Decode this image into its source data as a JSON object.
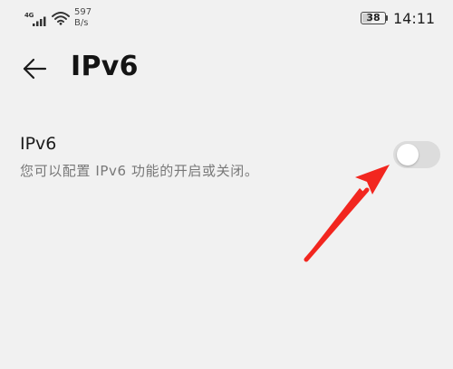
{
  "status_bar": {
    "network_type": "4G",
    "net_speed_value": "597",
    "net_speed_unit": "B/s",
    "battery_level": "38",
    "battery_fraction": 0.38,
    "time": "14:11",
    "icons": [
      "signal-icon",
      "wifi-icon",
      "battery-icon"
    ]
  },
  "header": {
    "title": "IPv6",
    "back_icon": "arrow-left-icon"
  },
  "setting": {
    "title": "IPv6",
    "description": "您可以配置 IPv6 功能的开启或关闭。",
    "enabled": false
  },
  "annotation": {
    "arrow_icon": "red-arrow-icon",
    "color": "#f2261f"
  },
  "colors": {
    "background": "#f1f1f1",
    "toggle_off": "#dcdcdc",
    "annotation": "#f2261f"
  }
}
